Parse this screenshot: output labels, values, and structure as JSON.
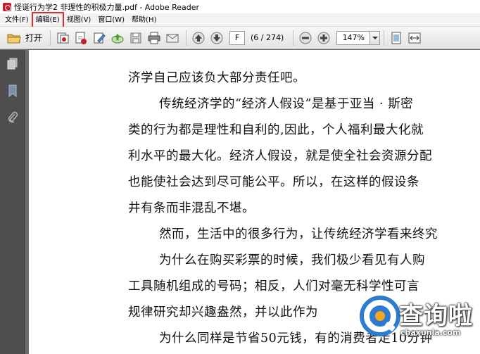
{
  "window": {
    "title": "怪诞行为学2 非理性的积极力量.pdf - Adobe Reader"
  },
  "menu": {
    "items": [
      {
        "label": "文件(F)"
      },
      {
        "label": "编辑(E)"
      },
      {
        "label": "视图(V)"
      },
      {
        "label": "窗口(W)"
      },
      {
        "label": "帮助(H)"
      }
    ],
    "highlighted_index": 1,
    "highlight_color": "#e32a2a"
  },
  "toolbar": {
    "open_label": "打开",
    "current_page": "F",
    "page_count": "(6 / 274)",
    "zoom": "147%",
    "icons": [
      "folder-open-icon",
      "print-icon",
      "comment-icon",
      "upload-icon",
      "save-icon",
      "email-icon",
      "page-up-icon",
      "page-down-icon",
      "zoom-out-icon",
      "zoom-in-icon",
      "fit-page-icon",
      "fit-width-icon"
    ]
  },
  "sidebar": {
    "icons": [
      "pages-icon",
      "bookmark-icon",
      "attachment-icon"
    ]
  },
  "document": {
    "lines": [
      "济学自己应该负大部分责任吧。",
      "传统经济学的“经济人假设”是基于亚当 · 斯密",
      "类的行为都是理性和自利的,因此，个人福利最大化就",
      "利水平的最大化。经济人假设，就是使全社会资源分配",
      "也能使社会达到尽可能公平。所以，在这样的假设条",
      "井有条而非混乱不堪。",
      "然而，生活中的很多行为，让传统经济学看来终究",
      "为什么在购买彩票的时候，我们极少看见有人购",
      "工具随机组成的号码；相反，人们对毫无科学性可言",
      "规律研究却兴趣盎然，并以此作为",
      "为什么同样是节省50元钱，有的消费者走10分钟"
    ]
  },
  "watermark": {
    "text": "查询啦",
    "url": "chaxunla.com",
    "brand_color": "#2d7bd0",
    "accent_color": "#f5a623"
  }
}
